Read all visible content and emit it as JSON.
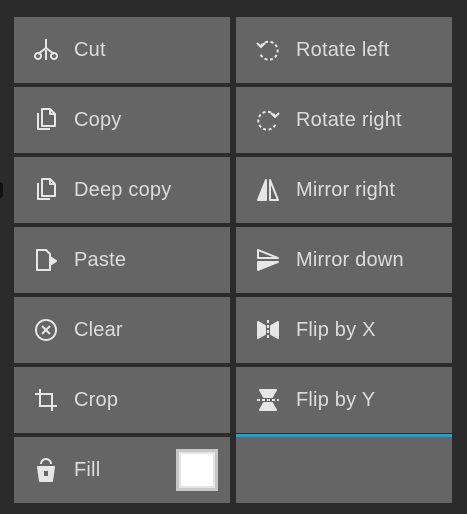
{
  "tools": {
    "left": [
      {
        "label": "Cut",
        "icon": "scissors-icon"
      },
      {
        "label": "Copy",
        "icon": "copy-icon"
      },
      {
        "label": "Deep copy",
        "icon": "deep-copy-icon"
      },
      {
        "label": "Paste",
        "icon": "paste-icon"
      },
      {
        "label": "Clear",
        "icon": "clear-icon"
      },
      {
        "label": "Crop",
        "icon": "crop-icon"
      },
      {
        "label": "Fill",
        "icon": "fill-bucket-icon"
      }
    ],
    "right": [
      {
        "label": "Rotate left",
        "icon": "rotate-left-icon"
      },
      {
        "label": "Rotate right",
        "icon": "rotate-right-icon"
      },
      {
        "label": "Mirror right",
        "icon": "mirror-right-icon"
      },
      {
        "label": "Mirror down",
        "icon": "mirror-down-icon"
      },
      {
        "label": "Flip by X",
        "icon": "flip-x-icon"
      },
      {
        "label": "Flip by Y",
        "icon": "flip-y-icon",
        "active": true
      },
      {
        "label": "",
        "icon": ""
      }
    ]
  },
  "fill_color": "#ffffff",
  "colors": {
    "background": "#2b2b2b",
    "button": "#656565",
    "text": "#dcdcdc",
    "accent": "#1aa3d9"
  }
}
